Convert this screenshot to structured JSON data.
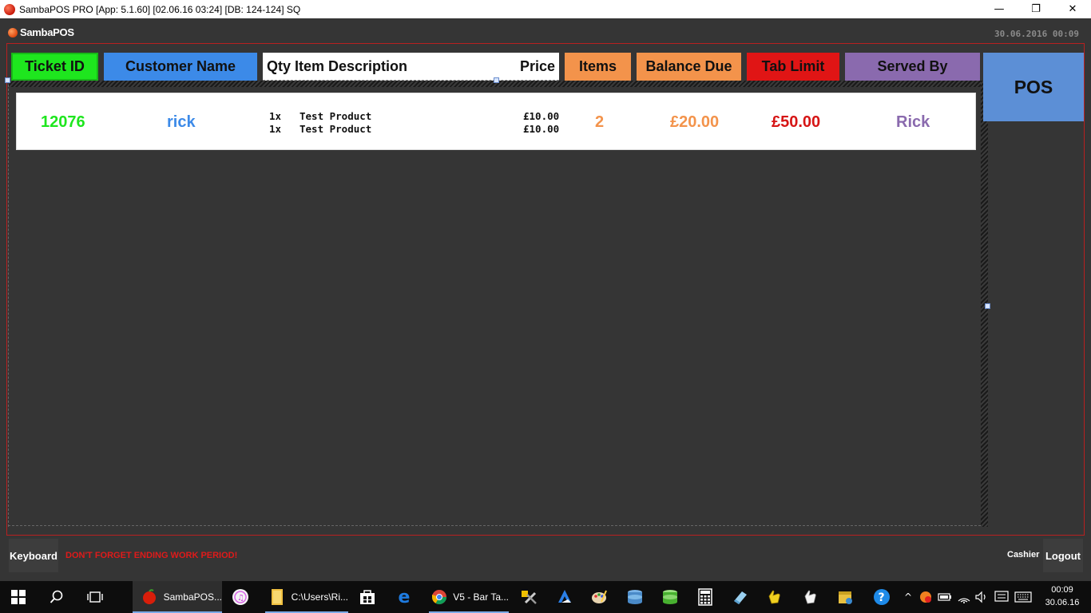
{
  "window": {
    "title": "SambaPOS PRO [App: 5.1.60] [02.06.16 03:24] [DB: 124-124] SQ",
    "minimize": "—",
    "restore": "❐",
    "close": "✕"
  },
  "app": {
    "logo_text": "SambaPOS",
    "datetime": "30.06.2016 00:09"
  },
  "columns": {
    "ticket_id": "Ticket ID",
    "customer_name": "Customer Name",
    "qty_item_description": "Qty Item Description",
    "price": "Price",
    "items": "Items",
    "balance_due": "Balance Due",
    "tab_limit": "Tab Limit",
    "served_by": "Served By"
  },
  "pos_button": "POS",
  "tickets": [
    {
      "ticket_id": "12076",
      "customer": "rick",
      "lines": [
        {
          "qty": "1x",
          "description": "Test Product",
          "price": "£10.00"
        },
        {
          "qty": "1x",
          "description": "Test Product",
          "price": "£10.00"
        }
      ],
      "items": "2",
      "balance_due": "£20.00",
      "tab_limit": "£50.00",
      "served_by": "Rick"
    }
  ],
  "bottom": {
    "keyboard": "Keyboard",
    "warning": "DON'T FORGET ENDING WORK PERIOD!",
    "role": "Cashier",
    "logout": "Logout"
  },
  "taskbar": {
    "items": [
      {
        "label": "SambaPOS...",
        "icon": "sambapos-icon"
      },
      {
        "label": "C:\\Users\\Ri...",
        "icon": "folder-icon"
      },
      {
        "label": "V5 - Bar Ta...",
        "icon": "chrome-icon"
      }
    ],
    "time": "00:09",
    "date": "30.06.16"
  },
  "colors": {
    "ticket_green": "#1ee61e",
    "customer_blue": "#3c8ae8",
    "orange": "#f3934b",
    "tab_red": "#e01515",
    "served_purple": "#8a6aae",
    "pos_blue": "#5c8fd6",
    "warning_red": "#e01a1a"
  }
}
